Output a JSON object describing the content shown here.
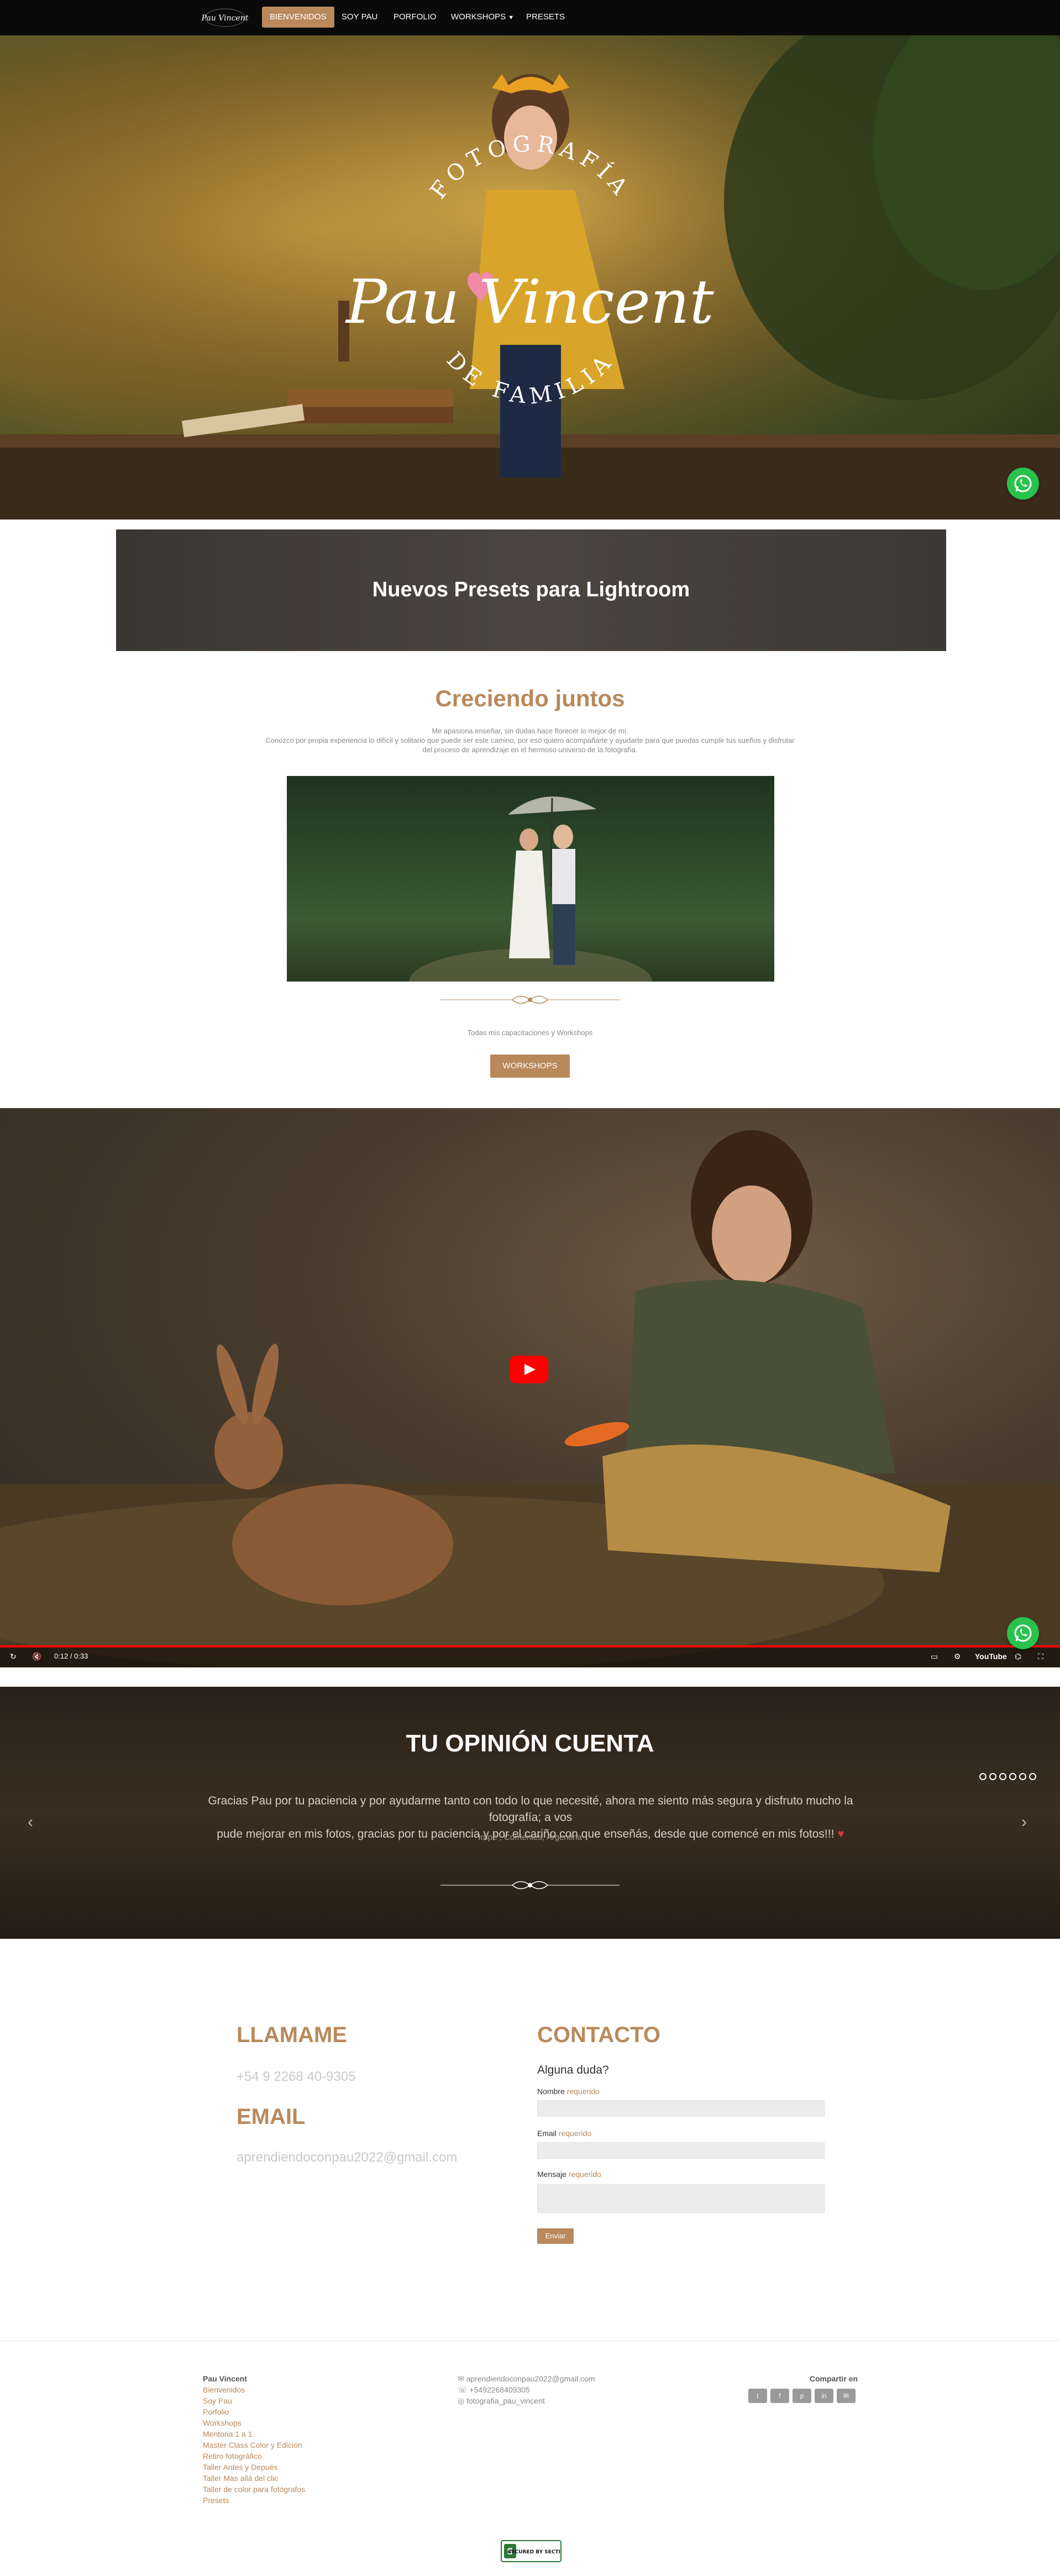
{
  "nav": {
    "logo_text": "Pau Vincent",
    "items": [
      {
        "label": "Bienvenidos",
        "active": true
      },
      {
        "label": "Soy Pau",
        "active": false
      },
      {
        "label": "Porfolio",
        "active": false
      },
      {
        "label": "Workshops",
        "active": false,
        "dropdown": true
      },
      {
        "label": "Presets",
        "active": false
      }
    ]
  },
  "hero": {
    "arc_top": "FOTOGRAFÍA",
    "script_name": "Pau Vincent",
    "arc_bottom": "DE FAMILIA"
  },
  "presets_banner": {
    "title": "Nuevos Presets para Lightroom"
  },
  "growing": {
    "title": "Creciendo juntos",
    "line1": "Me apasiona enseñar, sin dudas hace florecer lo mejor de mí.",
    "line2": "Conozco por propia experiencia lo difícil y solitario que puede ser este camino, por eso quiero acompañarte y ayudarte para que puedas cumplir tus sueños y disfrutar",
    "line3": "del proceso de aprendizaje en el hermoso universo de la fotografía.",
    "caption": "Todas mis capacitaciones y Workshops",
    "button": "Workshops"
  },
  "video": {
    "time": "0:12 / 0:33",
    "youtube_label": "YouTube"
  },
  "opinion": {
    "title": "TU OPINIÓN CUENTA",
    "text_line1": "Gracias Pau por tu paciencia y por ayudarme tanto con todo lo que necesité, ahora me siento más segura y disfruto mucho la fotografía; a vos",
    "text_line2": "pude mejorar en mis fotos, gracias por tu paciencia y por el cariño con que enseñás, desde que comencé en mis fotos!!!",
    "author": "Irupé , Corrientes, Argentina",
    "dot_count": 6
  },
  "contact": {
    "call_title": "LLAMAME",
    "phone": "+54 9 2268 40-9305",
    "email_title": "EMAIL",
    "email": "aprendiendoconpau2022@gmail.com",
    "form_title": "CONTACTO",
    "form_subtitle": "Alguna duda?",
    "name_label": "Nombre",
    "email_label": "Email",
    "message_label": "Mensaje",
    "required": "requerido",
    "send": "Enviar"
  },
  "footer": {
    "links": [
      "Pau Vincent",
      "Bienvenidos",
      "Soy Pau",
      "Porfolio",
      "Workshops",
      "Mentoria 1 a 1",
      "Master Class Color y Edición",
      "Retiro fotográfico",
      "Taller Antes y Depués",
      "Taller Mas allá del clic",
      "Taller de color para fotógrafos",
      "Presets"
    ],
    "contact_email": "aprendiendoconpau2022@gmail.com",
    "contact_phone": "+5492268409305",
    "contact_instagram": "fotografia_pau_vincent",
    "share_label": "Compartir en",
    "social": [
      "twitter",
      "facebook",
      "pinterest",
      "linkedin",
      "email"
    ],
    "badge": "SECURED BY SECTIGO"
  },
  "colors": {
    "accent": "#b9895c",
    "whatsapp": "#29c24d"
  }
}
